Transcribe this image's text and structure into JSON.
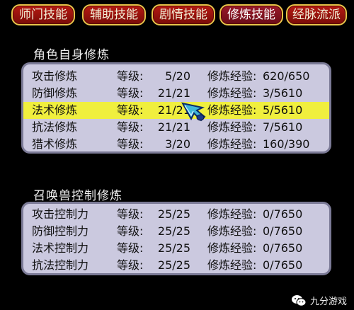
{
  "tabs": [
    {
      "label": "师门技能",
      "active": false
    },
    {
      "label": "辅助技能",
      "active": false
    },
    {
      "label": "剧情技能",
      "active": false
    },
    {
      "label": "修炼技能",
      "active": true
    },
    {
      "label": "经脉流派",
      "active": false
    }
  ],
  "self_training": {
    "title": "角色自身修炼",
    "rows": [
      {
        "name": "攻击修炼",
        "level_label": "等级:",
        "level": "5/20",
        "exp_label": "修炼经验:",
        "exp": "620/650",
        "selected": false
      },
      {
        "name": "防御修炼",
        "level_label": "等级:",
        "level": "21/21",
        "exp_label": "修炼经验:",
        "exp": "3/5610",
        "selected": false
      },
      {
        "name": "法术修炼",
        "level_label": "等级:",
        "level": "21/21",
        "exp_label": "修炼经验:",
        "exp": "5/5610",
        "selected": true
      },
      {
        "name": "抗法修炼",
        "level_label": "等级:",
        "level": "21/21",
        "exp_label": "修炼经验:",
        "exp": "7/5610",
        "selected": false
      },
      {
        "name": "猎术修炼",
        "level_label": "等级:",
        "level": "3/20",
        "exp_label": "修炼经验:",
        "exp": "160/390",
        "selected": false
      }
    ]
  },
  "pet_training": {
    "title": "召唤兽控制修炼",
    "rows": [
      {
        "name": "攻击控制力",
        "level_label": "等级:",
        "level": "25/25",
        "exp_label": "修炼经验:",
        "exp": "0/7650"
      },
      {
        "name": "防御控制力",
        "level_label": "等级:",
        "level": "25/25",
        "exp_label": "修炼经验:",
        "exp": "0/7650"
      },
      {
        "name": "法术控制力",
        "level_label": "等级:",
        "level": "25/25",
        "exp_label": "修炼经验:",
        "exp": "0/7650"
      },
      {
        "name": "抗法控制力",
        "level_label": "等级:",
        "level": "25/25",
        "exp_label": "修炼经验:",
        "exp": "0/7650"
      }
    ]
  },
  "watermark": {
    "text": "九分游戏"
  },
  "colors": {
    "highlight": "#f0ef3e",
    "panel": "#cbc9df",
    "tab": "#9a120c",
    "tab_border": "#e8c44a"
  }
}
